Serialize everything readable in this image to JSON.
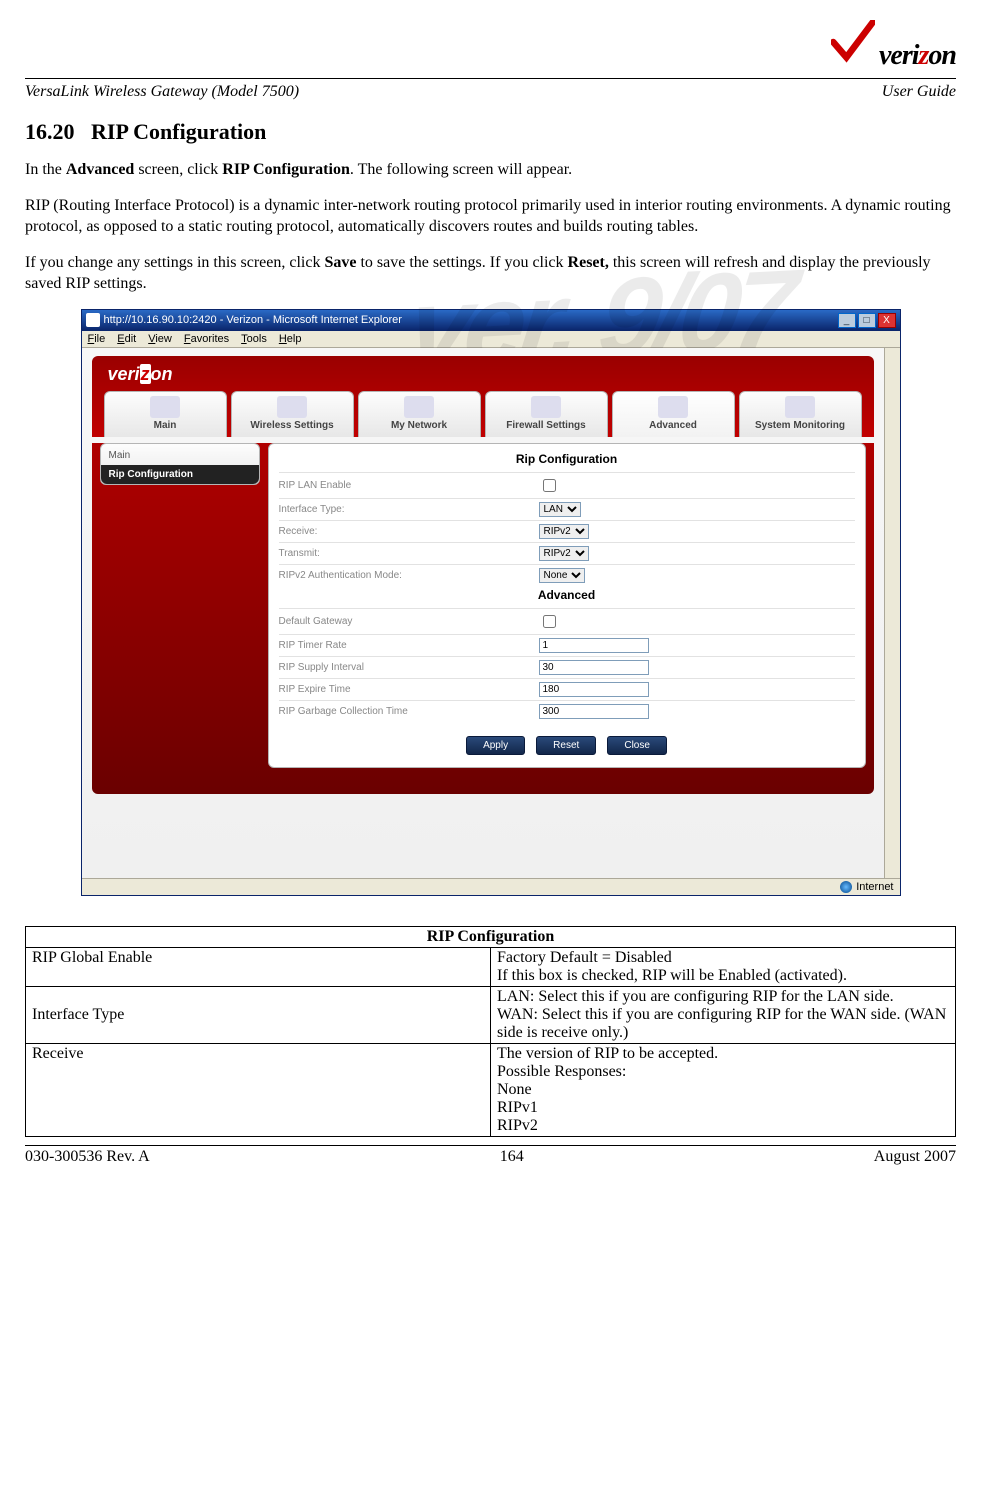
{
  "brand": {
    "name_prefix": "veri",
    "name_z": "z",
    "name_suffix": "on"
  },
  "header": {
    "left": "VersaLink Wireless Gateway (Model 7500)",
    "right": "User Guide"
  },
  "section": {
    "number": "16.20",
    "title": "RIP Configuration"
  },
  "paras": {
    "p1_a": "In the ",
    "p1_b": "Advanced",
    "p1_c": " screen, click ",
    "p1_d": "RIP Configuration",
    "p1_e": ". The following screen will appear.",
    "p2": "RIP (Routing Interface Protocol) is a dynamic inter-network routing protocol primarily used in interior routing environments. A dynamic routing protocol, as opposed to a static routing protocol, automatically discovers routes and builds routing tables.",
    "p3_a": "If you change any settings in this screen, click ",
    "p3_b": "Save",
    "p3_c": " to save the settings. If you click ",
    "p3_d": "Reset,",
    "p3_e": " this screen will refresh and display the previously saved RIP settings."
  },
  "ie": {
    "title": "http://10.16.90.10:2420 - Verizon - Microsoft Internet Explorer",
    "menus": [
      "File",
      "Edit",
      "View",
      "Favorites",
      "Tools",
      "Help"
    ],
    "win_min": "_",
    "win_max": "□",
    "win_close": "X",
    "status_left": "",
    "status_right": "Internet"
  },
  "router": {
    "tabs": [
      "Main",
      "Wireless Settings",
      "My Network",
      "Firewall Settings",
      "Advanced",
      "System Monitoring"
    ],
    "breadcrumb_top": "Main",
    "breadcrumb_current": "Rip Configuration",
    "panel1_title": "Rip Configuration",
    "panel2_title": "Advanced",
    "rows": {
      "rip_lan_enable": "RIP LAN Enable",
      "interface_type": "Interface Type:",
      "receive": "Receive:",
      "transmit": "Transmit:",
      "auth_mode": "RIPv2 Authentication Mode:",
      "default_gateway": "Default Gateway",
      "timer_rate": "RIP Timer Rate",
      "supply_interval": "RIP Supply Interval",
      "expire_time": "RIP Expire Time",
      "garbage": "RIP Garbage Collection Time"
    },
    "values": {
      "interface_type": "LAN",
      "receive": "RIPv2",
      "transmit": "RIPv2",
      "auth_mode": "None",
      "timer_rate": "1",
      "supply_interval": "30",
      "expire_time": "180",
      "garbage": "300"
    },
    "buttons": {
      "apply": "Apply",
      "reset": "Reset",
      "close": "Close"
    }
  },
  "table": {
    "header": "RIP Configuration",
    "rows": [
      {
        "c1": "RIP Global Enable",
        "c2": "Factory Default = Disabled\nIf this box is checked, RIP will be Enabled (activated)."
      },
      {
        "c1": "Interface Type",
        "c2": "LAN: Select this if you are configuring RIP for the LAN side.\nWAN: Select this if you are configuring RIP for the WAN side. (WAN side is receive only.)"
      },
      {
        "c1": "Receive",
        "c2": "The version of RIP to be accepted.\nPossible Responses:\nNone\nRIPv1\nRIPv2"
      }
    ]
  },
  "footer": {
    "left": "030-300536 Rev. A",
    "center": "164",
    "right": "August 2007"
  },
  "watermark": "ver. 9/07"
}
